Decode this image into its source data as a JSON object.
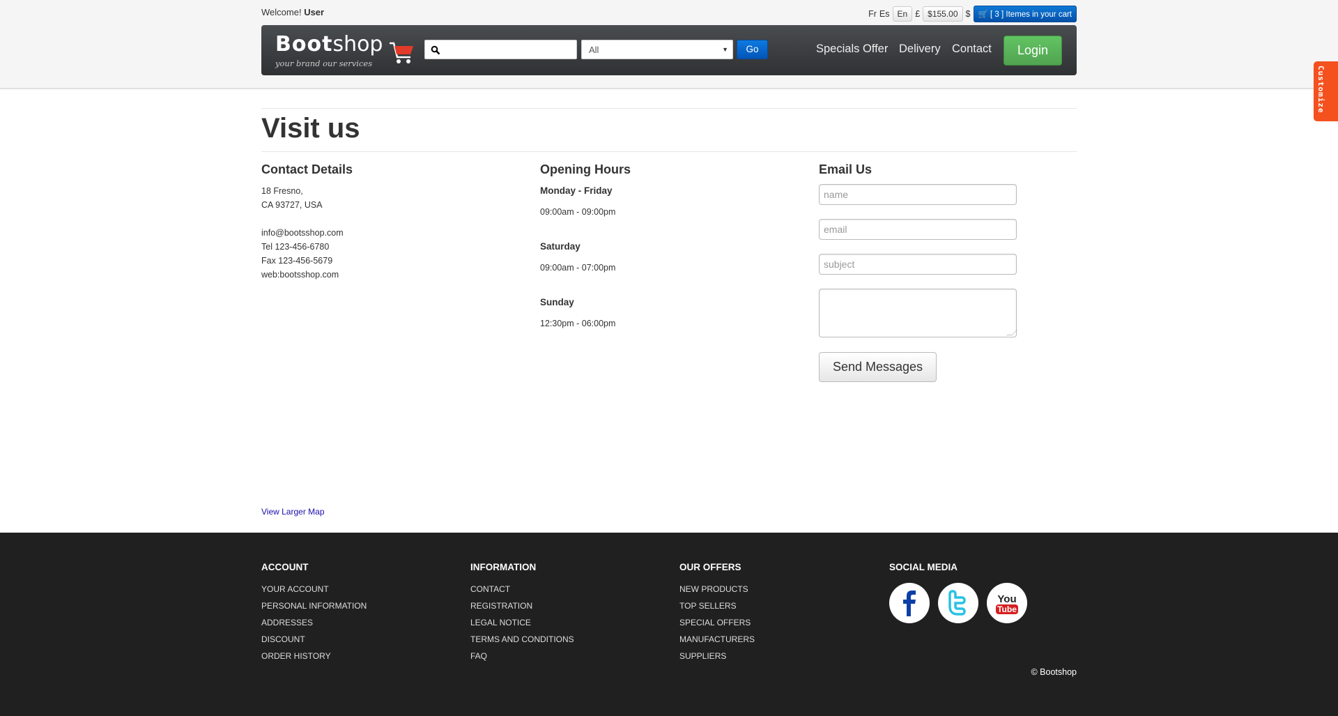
{
  "topbar": {
    "welcome_prefix": "Welcome!",
    "user": "User",
    "lang_fr": "Fr",
    "lang_es": "Es",
    "lang_en": "En",
    "currency_gbp": "£",
    "cart_total": "$155.00",
    "currency_usd": "$",
    "cart_label": "[ 3 ] Itemes in your cart"
  },
  "navbar": {
    "logo_main_bold": "Boot",
    "logo_main": "shop",
    "logo_tagline": "your brand our services",
    "search_placeholder": "",
    "category_selected": "All",
    "go_label": "Go",
    "links": [
      "Specials Offer",
      "Delivery",
      "Contact"
    ],
    "login_label": "Login"
  },
  "customize_tab": "Customize",
  "page": {
    "title": "Visit us"
  },
  "contact": {
    "heading": "Contact Details",
    "address_line1": "18 Fresno,",
    "address_line2": "CA 93727, USA",
    "email": "info@bootsshop.com",
    "tel": "Tel 123-456-6780",
    "fax": "Fax 123-456-5679",
    "web": "web:bootsshop.com"
  },
  "hours": {
    "heading": "Opening Hours",
    "days": [
      {
        "day": "Monday - Friday",
        "time": "09:00am - 09:00pm"
      },
      {
        "day": "Saturday",
        "time": "09:00am - 07:00pm"
      },
      {
        "day": "Sunday",
        "time": "12:30pm - 06:00pm"
      }
    ]
  },
  "email_form": {
    "heading": "Email Us",
    "name_placeholder": "name",
    "email_placeholder": "email",
    "subject_placeholder": "subject",
    "send_label": "Send Messages"
  },
  "map_link": "View Larger Map",
  "footer": {
    "account": {
      "heading": "ACCOUNT",
      "links": [
        "YOUR ACCOUNT",
        "PERSONAL INFORMATION",
        "ADDRESSES",
        "DISCOUNT",
        "ORDER HISTORY"
      ]
    },
    "information": {
      "heading": "INFORMATION",
      "links": [
        "CONTACT",
        "REGISTRATION",
        "LEGAL NOTICE",
        "TERMS AND CONDITIONS",
        "FAQ"
      ]
    },
    "offers": {
      "heading": "OUR OFFERS",
      "links": [
        "NEW PRODUCTS",
        "TOP SELLERS",
        "SPECIAL OFFERS",
        "MANUFACTURERS",
        "SUPPLIERS"
      ]
    },
    "social": {
      "heading": "SOCIAL MEDIA",
      "icons": [
        "facebook-icon",
        "twitter-icon",
        "youtube-icon"
      ],
      "youtube_you": "You",
      "youtube_tube": "Tube"
    },
    "copyright": "© Bootshop"
  },
  "colors": {
    "navbar": "#3b3e41",
    "login_green": "#5bb75b",
    "go_blue": "#0866cf",
    "customize_orange": "#f4511e",
    "footer_bg": "#202020",
    "link_blue": "#1a0dab"
  }
}
